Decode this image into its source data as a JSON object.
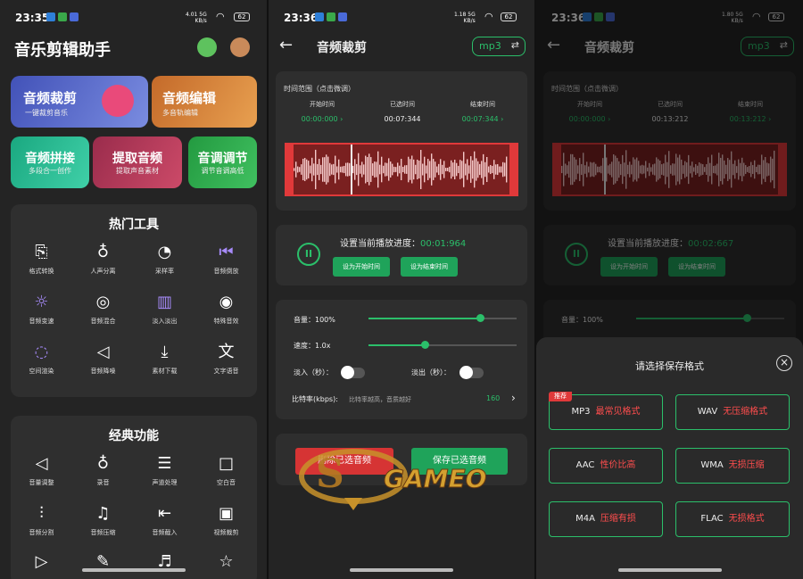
{
  "phone1": {
    "status": {
      "time": "23:35",
      "net1": "4.01",
      "net2": "KB/s",
      "net3": "5G",
      "battery": "62"
    },
    "title": "音乐剪辑助手",
    "cards": [
      {
        "label": "音频裁剪",
        "sub": "一键裁剪音乐",
        "color": "#4f5fc4"
      },
      {
        "label": "音频编辑",
        "sub": "多音轨编辑",
        "color": "#d98030"
      },
      {
        "label": "音频拼接",
        "sub": "多段合一创作",
        "color": "#1fb08a"
      },
      {
        "label": "提取音频",
        "sub": "提取声音素材",
        "color": "#b03a58"
      },
      {
        "label": "音调调节",
        "sub": "调节音调高低",
        "color": "#2faa4a"
      }
    ],
    "hot_title": "热门工具",
    "hot_tools": [
      "格式转换",
      "人声分离",
      "采样率",
      "音频倒放",
      "音频变速",
      "音频混合",
      "淡入淡出",
      "特殊音效",
      "空间渲染",
      "音频降噪",
      "素材下载",
      "文字语音"
    ],
    "classic_title": "经典功能",
    "classic_tools": [
      "音量调整",
      "录音",
      "声道处理",
      "空白音",
      "音频分割",
      "音频压缩",
      "音频截入",
      "视频裁剪"
    ]
  },
  "phone2": {
    "status": {
      "time": "23:36",
      "net1": "1.18",
      "net2": "KB/s",
      "net3": "5G",
      "battery": "62"
    },
    "title": "音频裁剪",
    "format": "mp3",
    "range_label": "时间范围（点击微调）",
    "start_label": "开始时间",
    "selected_label": "已选时间",
    "end_label": "结束时间",
    "start_time": "00:00:000",
    "selected_time": "00:07:344",
    "end_time": "00:07:344",
    "progress_label": "设置当前播放进度：",
    "progress_time": "00:01:964",
    "set_start": "设为开始时间",
    "set_end": "设为结束时间",
    "volume_label": "音量：100%",
    "volume_level": 0.75,
    "speed_label": "速度：1.0x",
    "speed_level": 0.38,
    "fade_in": "淡入（秒）：",
    "fade_out": "淡出（秒）：",
    "bitrate_label": "比特率(kbps):",
    "bitrate_hint": "比特率越高，音质越好",
    "bitrate_value": "160",
    "btn_left": "删除已选音频",
    "btn_right": "保存已选音频"
  },
  "phone3": {
    "status": {
      "time": "23:36",
      "net1": "1.80",
      "net2": "KB/s",
      "net3": "5G",
      "battery": "62"
    },
    "title": "音频裁剪",
    "format": "mp3",
    "range_label": "时间范围（点击微调）",
    "start_label": "开始时间",
    "selected_label": "已选时间",
    "end_label": "结束时间",
    "start_time": "00:00:000",
    "selected_time": "00:13:212",
    "end_time": "00:13:212",
    "progress_label": "设置当前播放进度：",
    "progress_time": "00:02:667",
    "set_start": "设为开始时间",
    "set_end": "设为结束时间",
    "volume_label": "音量：100%",
    "sheet_title": "请选择保存格式",
    "recommend": "推荐",
    "formats": [
      {
        "name": "MP3",
        "desc": "最常见格式"
      },
      {
        "name": "WAV",
        "desc": "无压缩格式"
      },
      {
        "name": "AAC",
        "desc": "性价比高"
      },
      {
        "name": "WMA",
        "desc": "无损压缩"
      },
      {
        "name": "M4A",
        "desc": "压缩有损"
      },
      {
        "name": "FLAC",
        "desc": "无损格式"
      }
    ]
  },
  "watermark": "GAMEO",
  "colors": {
    "accent": "#2bbf6a",
    "danger": "#e0393a"
  }
}
